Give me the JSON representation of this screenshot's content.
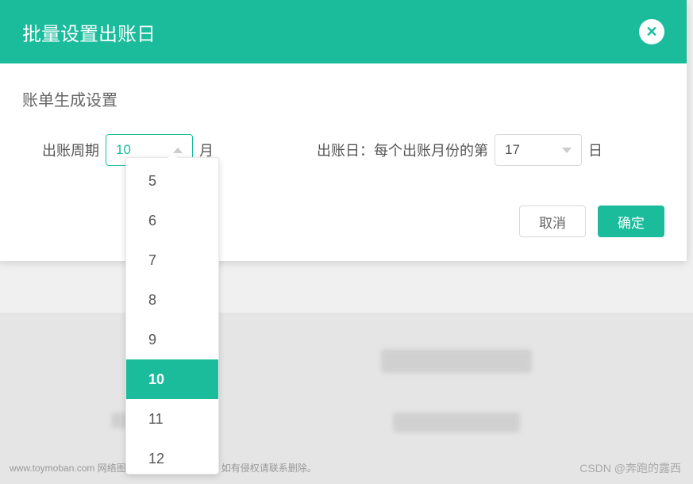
{
  "modal": {
    "title": "批量设置出账日",
    "section_title": "账单生成设置",
    "period_label": "出账周期",
    "period_value": "10",
    "period_unit": "月",
    "day_label": "出账日：每个出账月份的第",
    "day_value": "17",
    "day_unit": "日",
    "cancel": "取消",
    "confirm": "确定"
  },
  "dropdown": {
    "options": [
      "5",
      "6",
      "7",
      "8",
      "9",
      "10",
      "11",
      "12"
    ],
    "selected": "10"
  },
  "footer": {
    "disclaimer": "www.toymoban.com 网络图片仅供展示，非存储，如有侵权请联系删除。",
    "watermark": "CSDN @奔跑的露西"
  }
}
